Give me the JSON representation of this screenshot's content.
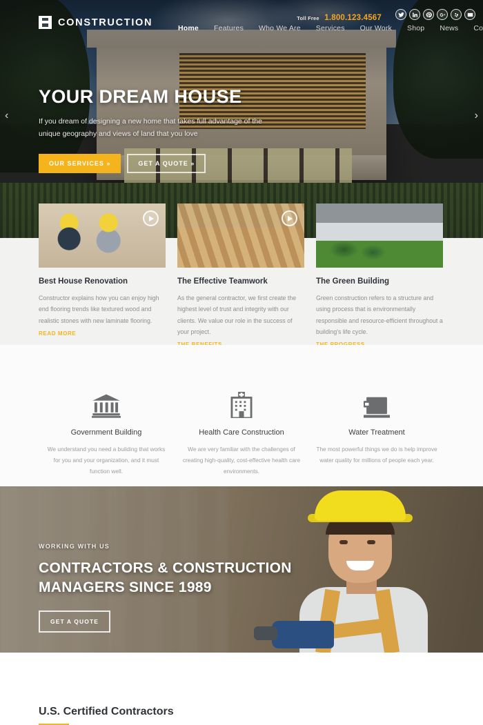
{
  "header": {
    "logo_text": "CONSTRUCTION",
    "logo_icon": "construction-bracket-logo-icon",
    "toll_label": "Toll Free",
    "toll_number": "1.800.123.4567",
    "socials": [
      {
        "name": "twitter-icon",
        "glyph": "t"
      },
      {
        "name": "linkedin-icon",
        "glyph": "in"
      },
      {
        "name": "pinterest-icon",
        "glyph": "p"
      },
      {
        "name": "google-plus-icon",
        "glyph": "g+"
      },
      {
        "name": "yelp-icon",
        "glyph": "y"
      },
      {
        "name": "email-icon",
        "glyph": "@"
      }
    ],
    "nav": [
      {
        "label": "Home",
        "active": true
      },
      {
        "label": "Features",
        "active": false
      },
      {
        "label": "Who We Are",
        "active": false
      },
      {
        "label": "Services",
        "active": false
      },
      {
        "label": "Our Work",
        "active": false
      },
      {
        "label": "Shop",
        "active": false
      },
      {
        "label": "News",
        "active": false
      },
      {
        "label": "Contact Us",
        "active": false
      }
    ]
  },
  "hero": {
    "title": "YOUR DREAM HOUSE",
    "subtitle": "If you dream of designing a new home that takes full advantage of the unique geography and views of land that you love",
    "primary_button": "OUR SERVICES »",
    "secondary_button": "GET A QUOTE »",
    "prev_arrow": "‹",
    "next_arrow": "›"
  },
  "cards": [
    {
      "title": "Best House Renovation",
      "body": "Constructor explains how you can enjoy high end flooring trends like textured wood and realistic stones with new laminate flooring.",
      "link": "READ MORE",
      "has_play": true,
      "image_name": "two-construction-workers-photo"
    },
    {
      "title": "The Effective Teamwork",
      "body": "As the general contractor, we first create the highest level of trust and integrity with our clients. We value our role in the success of your project.",
      "link": "THE BENEFITS",
      "has_play": true,
      "image_name": "framing-crew-raising-wall-photo"
    },
    {
      "title": "The Green Building",
      "body": "Green construction refers to a structure and using process that is environmentally responsible and resource-efficient throughout a building's life cycle.",
      "link": "THE PROGRESS",
      "has_play": false,
      "image_name": "suburban-house-exterior-photo"
    }
  ],
  "certified": {
    "title": "U.S. Certified Contractors",
    "services": [
      {
        "icon": "government-building-icon",
        "title": "Government Building",
        "body": "We understand you need a building that works for you and your organization, and it must function well."
      },
      {
        "icon": "hospital-building-icon",
        "title": "Health Care Construction",
        "body": "We are very familiar with the challenges of creating high-quality, cost-effective health care environments."
      },
      {
        "icon": "water-jug-icon",
        "title": "Water Treatment",
        "body": "The most powerful things we do is help improve water quality for millions of people each year."
      }
    ]
  },
  "cta": {
    "kicker": "WORKING WITH US",
    "title_line1": "CONTRACTORS & CONSTRUCTION",
    "title_line2": "MANAGERS SINCE 1989",
    "button": "GET A QUOTE",
    "image_name": "smiling-worker-with-drill-photo"
  },
  "colors": {
    "accent": "#f5b31c",
    "heading": "#2f3337",
    "body_text": "#8d8f91",
    "icon_gray": "#6b6d6f"
  }
}
